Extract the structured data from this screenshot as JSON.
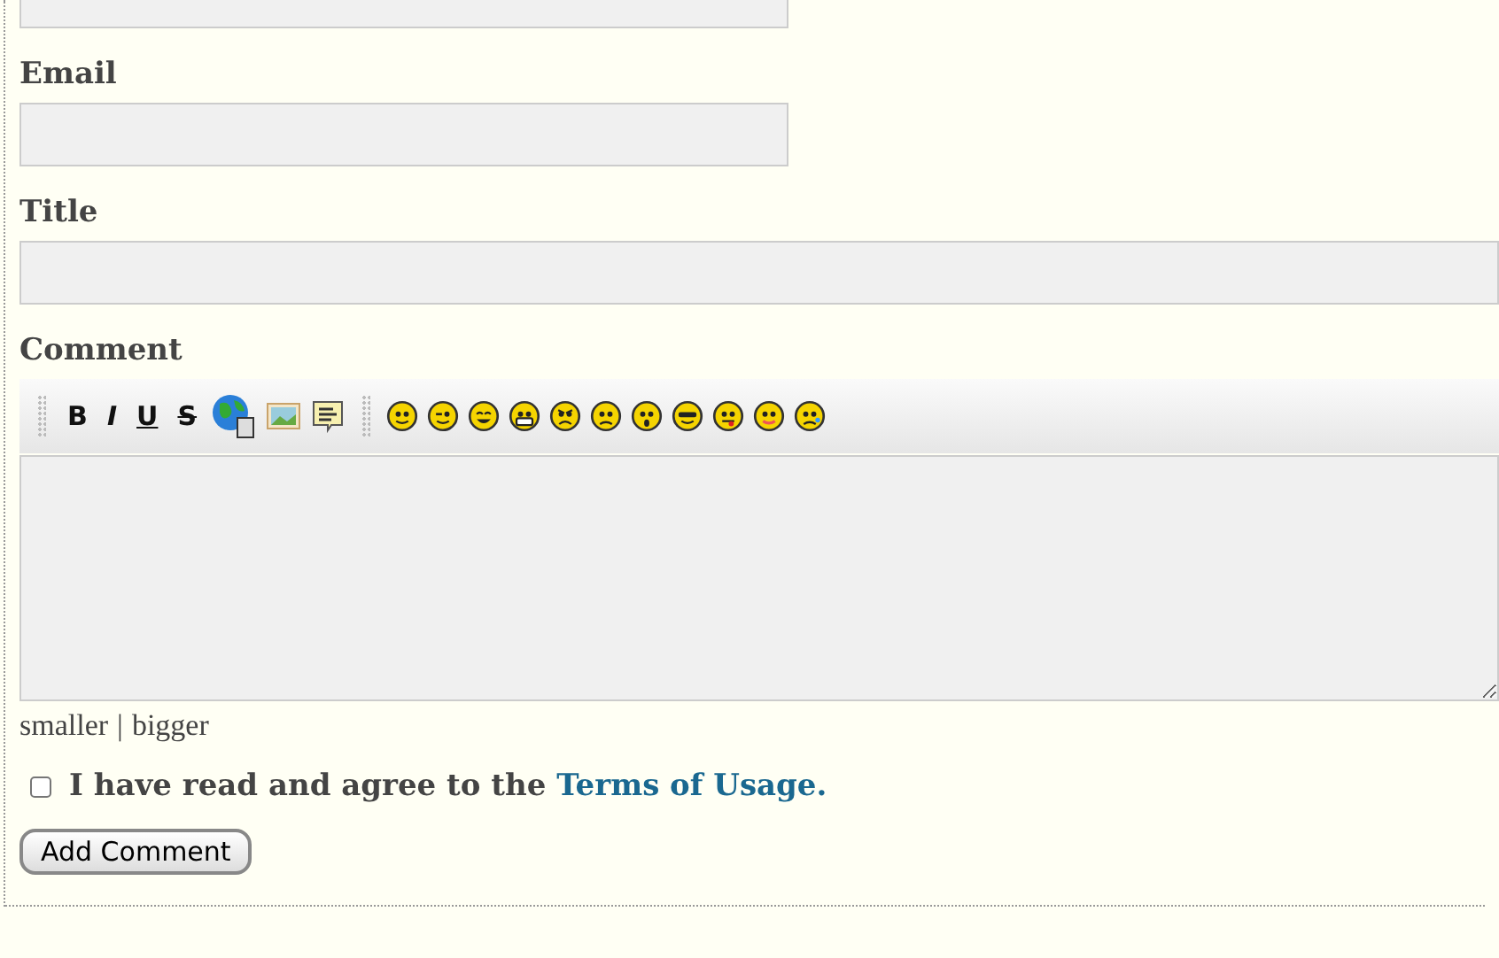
{
  "fields": [
    {
      "kind": "short"
    },
    {
      "label": "Email",
      "kind": "short"
    },
    {
      "label": "Title",
      "kind": "wide"
    }
  ],
  "comment": {
    "label": "Comment",
    "format_buttons": [
      {
        "kind": "bold",
        "text": "B"
      },
      {
        "kind": "italic",
        "text": "I"
      },
      {
        "kind": "underline",
        "text": "U"
      },
      {
        "kind": "strike",
        "text": "S"
      }
    ],
    "resize_links": [
      "smaller",
      "bigger"
    ],
    "separator": "|"
  },
  "agree": {
    "checked": false,
    "text": "I have read and agree to the ",
    "link": "Terms of Usage."
  },
  "submit": "Add Comment"
}
